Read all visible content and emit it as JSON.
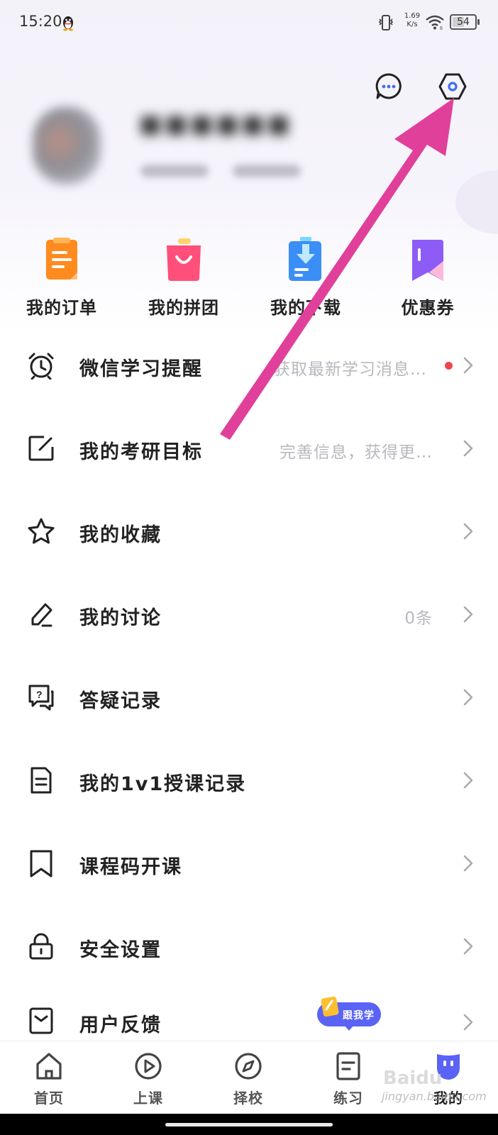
{
  "status_bar": {
    "time": "15:20",
    "net_speed_value": "1.69",
    "net_speed_unit": "K/s",
    "battery": "54",
    "battery_level_percent": 54
  },
  "header": {
    "message_icon": "chat-bubble-icon",
    "settings_icon": "gear-icon"
  },
  "quick_actions": [
    {
      "label": "我的订单",
      "icon": "order-icon",
      "color": "#ff8a1f"
    },
    {
      "label": "我的拼团",
      "icon": "shopping-bag-icon",
      "color": "#ff4f7a"
    },
    {
      "label": "我的下载",
      "icon": "download-icon",
      "color": "#3b8ef5"
    },
    {
      "label": "优惠券",
      "icon": "coupon-icon",
      "color": "#8d5cf6"
    }
  ],
  "menu": [
    {
      "label": "微信学习提醒",
      "hint": "获取最新学习消息…",
      "icon": "alarm-clock-icon",
      "has_dot": true
    },
    {
      "label": "我的考研目标",
      "hint": "完善信息，获得更…",
      "icon": "edit-square-icon"
    },
    {
      "label": "我的收藏",
      "hint": "",
      "icon": "star-icon"
    },
    {
      "label": "我的讨论",
      "hint": "0条",
      "icon": "pencil-icon"
    },
    {
      "label": "答疑记录",
      "hint": "",
      "icon": "question-chat-icon"
    },
    {
      "label": "我的1v1授课记录",
      "hint": "",
      "icon": "document-icon"
    },
    {
      "label": "课程码开课",
      "hint": "",
      "icon": "bookmark-icon"
    },
    {
      "label": "安全设置",
      "hint": "",
      "icon": "lock-icon"
    },
    {
      "label": "用户反馈",
      "hint": "",
      "icon": "feedback-icon"
    }
  ],
  "follow_badge": {
    "label": "跟我学"
  },
  "bottom_nav": [
    {
      "label": "首页",
      "icon": "home-icon"
    },
    {
      "label": "上课",
      "icon": "play-circle-icon"
    },
    {
      "label": "择校",
      "icon": "compass-icon"
    },
    {
      "label": "练习",
      "icon": "practice-icon"
    },
    {
      "label": "我的",
      "icon": "profile-face-icon",
      "active": true
    }
  ],
  "watermark": {
    "logo": "Baidu",
    "site": "jingyan.baidu.com"
  },
  "colors": {
    "accent": "#5a63f6",
    "annotation_arrow": "#e0409a",
    "dot_red": "#f0454f",
    "hint_gray": "#b8b8be"
  }
}
